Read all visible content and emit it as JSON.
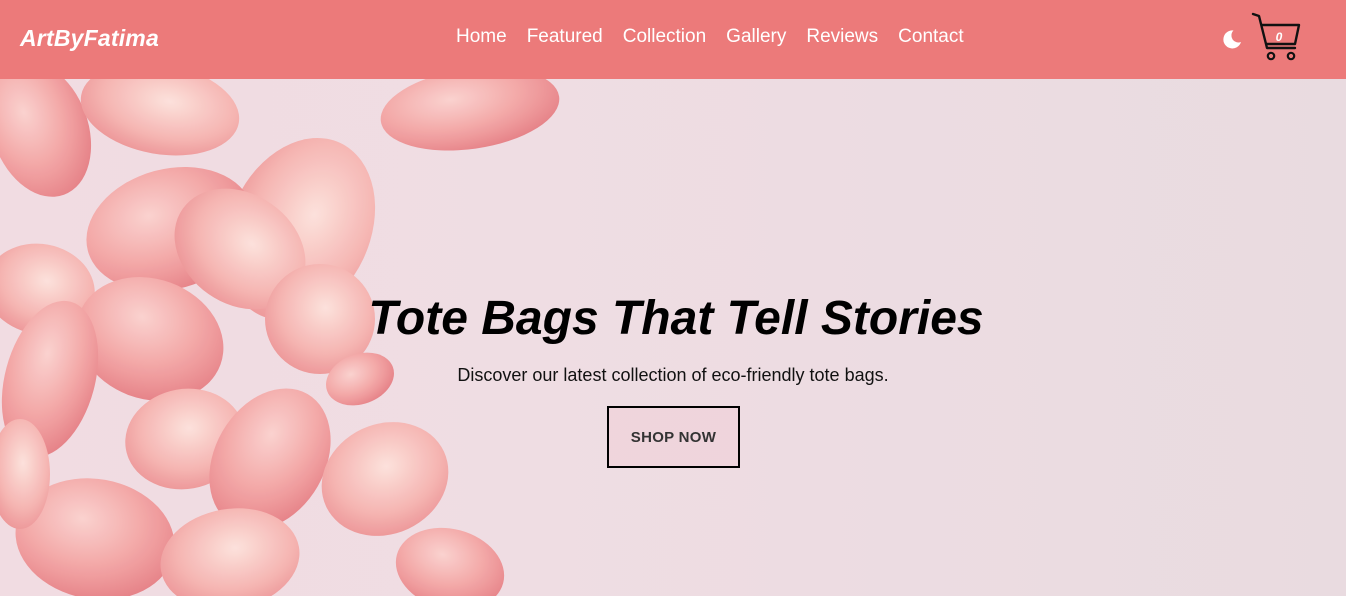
{
  "brand": {
    "name": "ArtByFatima"
  },
  "nav": {
    "items": [
      {
        "label": "Home"
      },
      {
        "label": "Featured"
      },
      {
        "label": "Collection"
      },
      {
        "label": "Gallery"
      },
      {
        "label": "Reviews"
      },
      {
        "label": "Contact"
      }
    ]
  },
  "header_actions": {
    "theme_toggle_icon": "moon-icon",
    "cart_icon": "cart-icon",
    "cart_count": "0"
  },
  "hero": {
    "title": "Tote Bags That Tell Stories",
    "subtitle": "Discover our latest collection of eco-friendly tote bags.",
    "cta_label": "SHOP NOW",
    "background_image": "rose-petals-image"
  },
  "colors": {
    "header_bg": "#ec7a7a",
    "hero_bg": "#ead9df",
    "petal": "#f2a0a0",
    "text_dark": "#000000",
    "text_light": "#ffffff"
  }
}
